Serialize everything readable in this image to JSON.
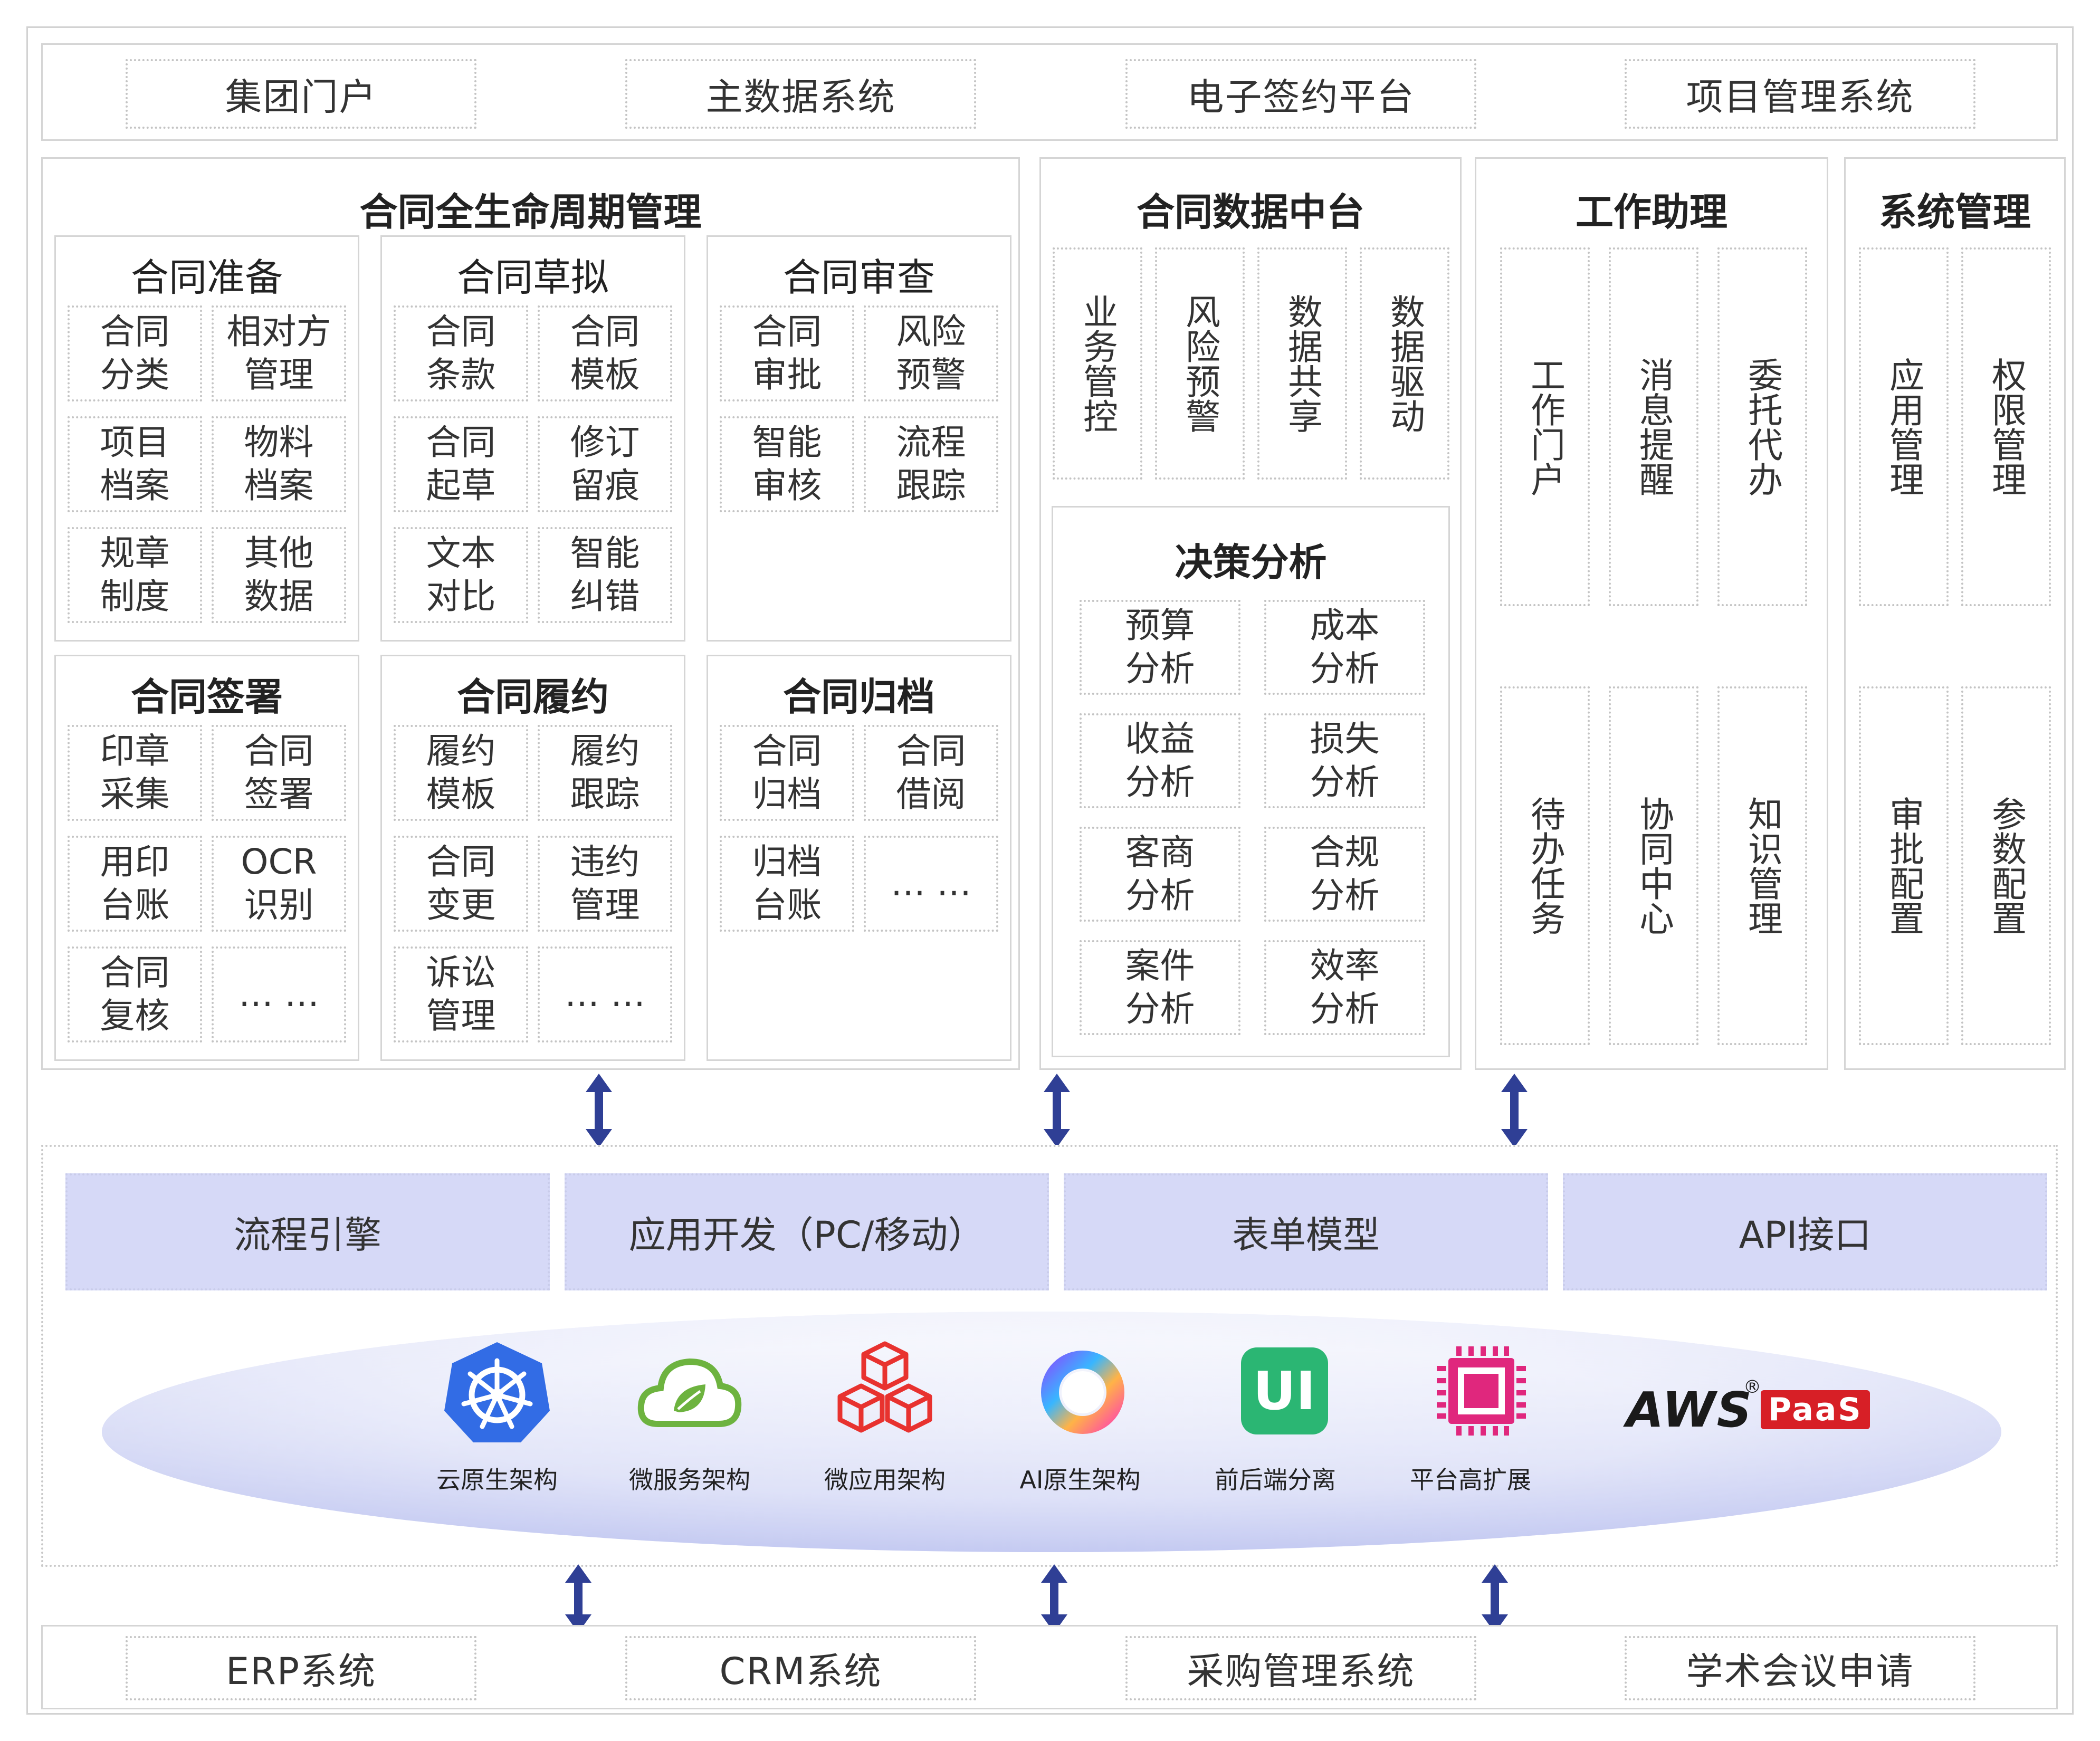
{
  "top_systems": [
    "集团门户",
    "主数据系统",
    "电子签约平台",
    "项目管理系统"
  ],
  "lifecycle": {
    "title": "合同全生命周期管理",
    "groups": [
      {
        "title": "合同准备",
        "bold": false,
        "items": [
          "合同\n分类",
          "相对方\n管理",
          "项目\n档案",
          "物料\n档案",
          "规章\n制度",
          "其他\n数据"
        ]
      },
      {
        "title": "合同草拟",
        "bold": false,
        "items": [
          "合同\n条款",
          "合同\n模板",
          "合同\n起草",
          "修订\n留痕",
          "文本\n对比",
          "智能\n纠错"
        ]
      },
      {
        "title": "合同审查",
        "bold": false,
        "items": [
          "合同\n审批",
          "风险\n预警",
          "智能\n审核",
          "流程\n跟踪"
        ]
      },
      {
        "title": "合同签署",
        "bold": true,
        "items": [
          "印章\n采集",
          "合同\n签署",
          "用印\n台账",
          "OCR\n识别",
          "合同\n复核",
          "… …"
        ]
      },
      {
        "title": "合同履约",
        "bold": true,
        "items": [
          "履约\n模板",
          "履约\n跟踪",
          "合同\n变更",
          "违约\n管理",
          "诉讼\n管理",
          "… …"
        ]
      },
      {
        "title": "合同归档",
        "bold": true,
        "items": [
          "合同\n归档",
          "合同\n借阅",
          "归档\n台账",
          "… …"
        ]
      }
    ]
  },
  "data_center": {
    "title": "合同数据中台",
    "items": [
      "业务管控",
      "风险预警",
      "数据共享",
      "数据驱动"
    ],
    "decision": {
      "title": "决策分析",
      "items": [
        "预算\n分析",
        "成本\n分析",
        "收益\n分析",
        "损失\n分析",
        "客商\n分析",
        "合规\n分析",
        "案件\n分析",
        "效率\n分析"
      ]
    }
  },
  "assistant": {
    "title": "工作助理",
    "items": [
      "工作门户",
      "消息提醒",
      "委托代办",
      "待办任务",
      "协同中心",
      "知识管理"
    ]
  },
  "sysmgmt": {
    "title": "系统管理",
    "items": [
      "应用管理",
      "权限管理",
      "审批配置",
      "参数配置"
    ]
  },
  "platform_bars": [
    "流程引擎",
    "应用开发（PC/移动）",
    "表单模型",
    "API接口"
  ],
  "tech": [
    {
      "label": "云原生架构",
      "icon": "kubernetes-icon"
    },
    {
      "label": "微服务架构",
      "icon": "spring-cloud-icon"
    },
    {
      "label": "微应用架构",
      "icon": "cubes-icon"
    },
    {
      "label": "AI原生架构",
      "icon": "ai-ring-icon"
    },
    {
      "label": "前后端分离",
      "icon": "ui-icon"
    },
    {
      "label": "平台高扩展",
      "icon": "chip-icon"
    }
  ],
  "brand": {
    "name": "AWS",
    "sup": "®",
    "tag": "PaaS"
  },
  "bottom_systems": [
    "ERP系统",
    "CRM系统",
    "采购管理系统",
    "学术会议申请"
  ],
  "colors": {
    "arrow": "#2f3f95",
    "bar": "#d6d9f7",
    "ellipse": "#c5cbf3",
    "brand_red": "#d71f26",
    "k8s": "#326ce5",
    "spring": "#6db33f",
    "cube": "#e8322f",
    "ui": "#2bb673",
    "chip": "#e0277d"
  }
}
